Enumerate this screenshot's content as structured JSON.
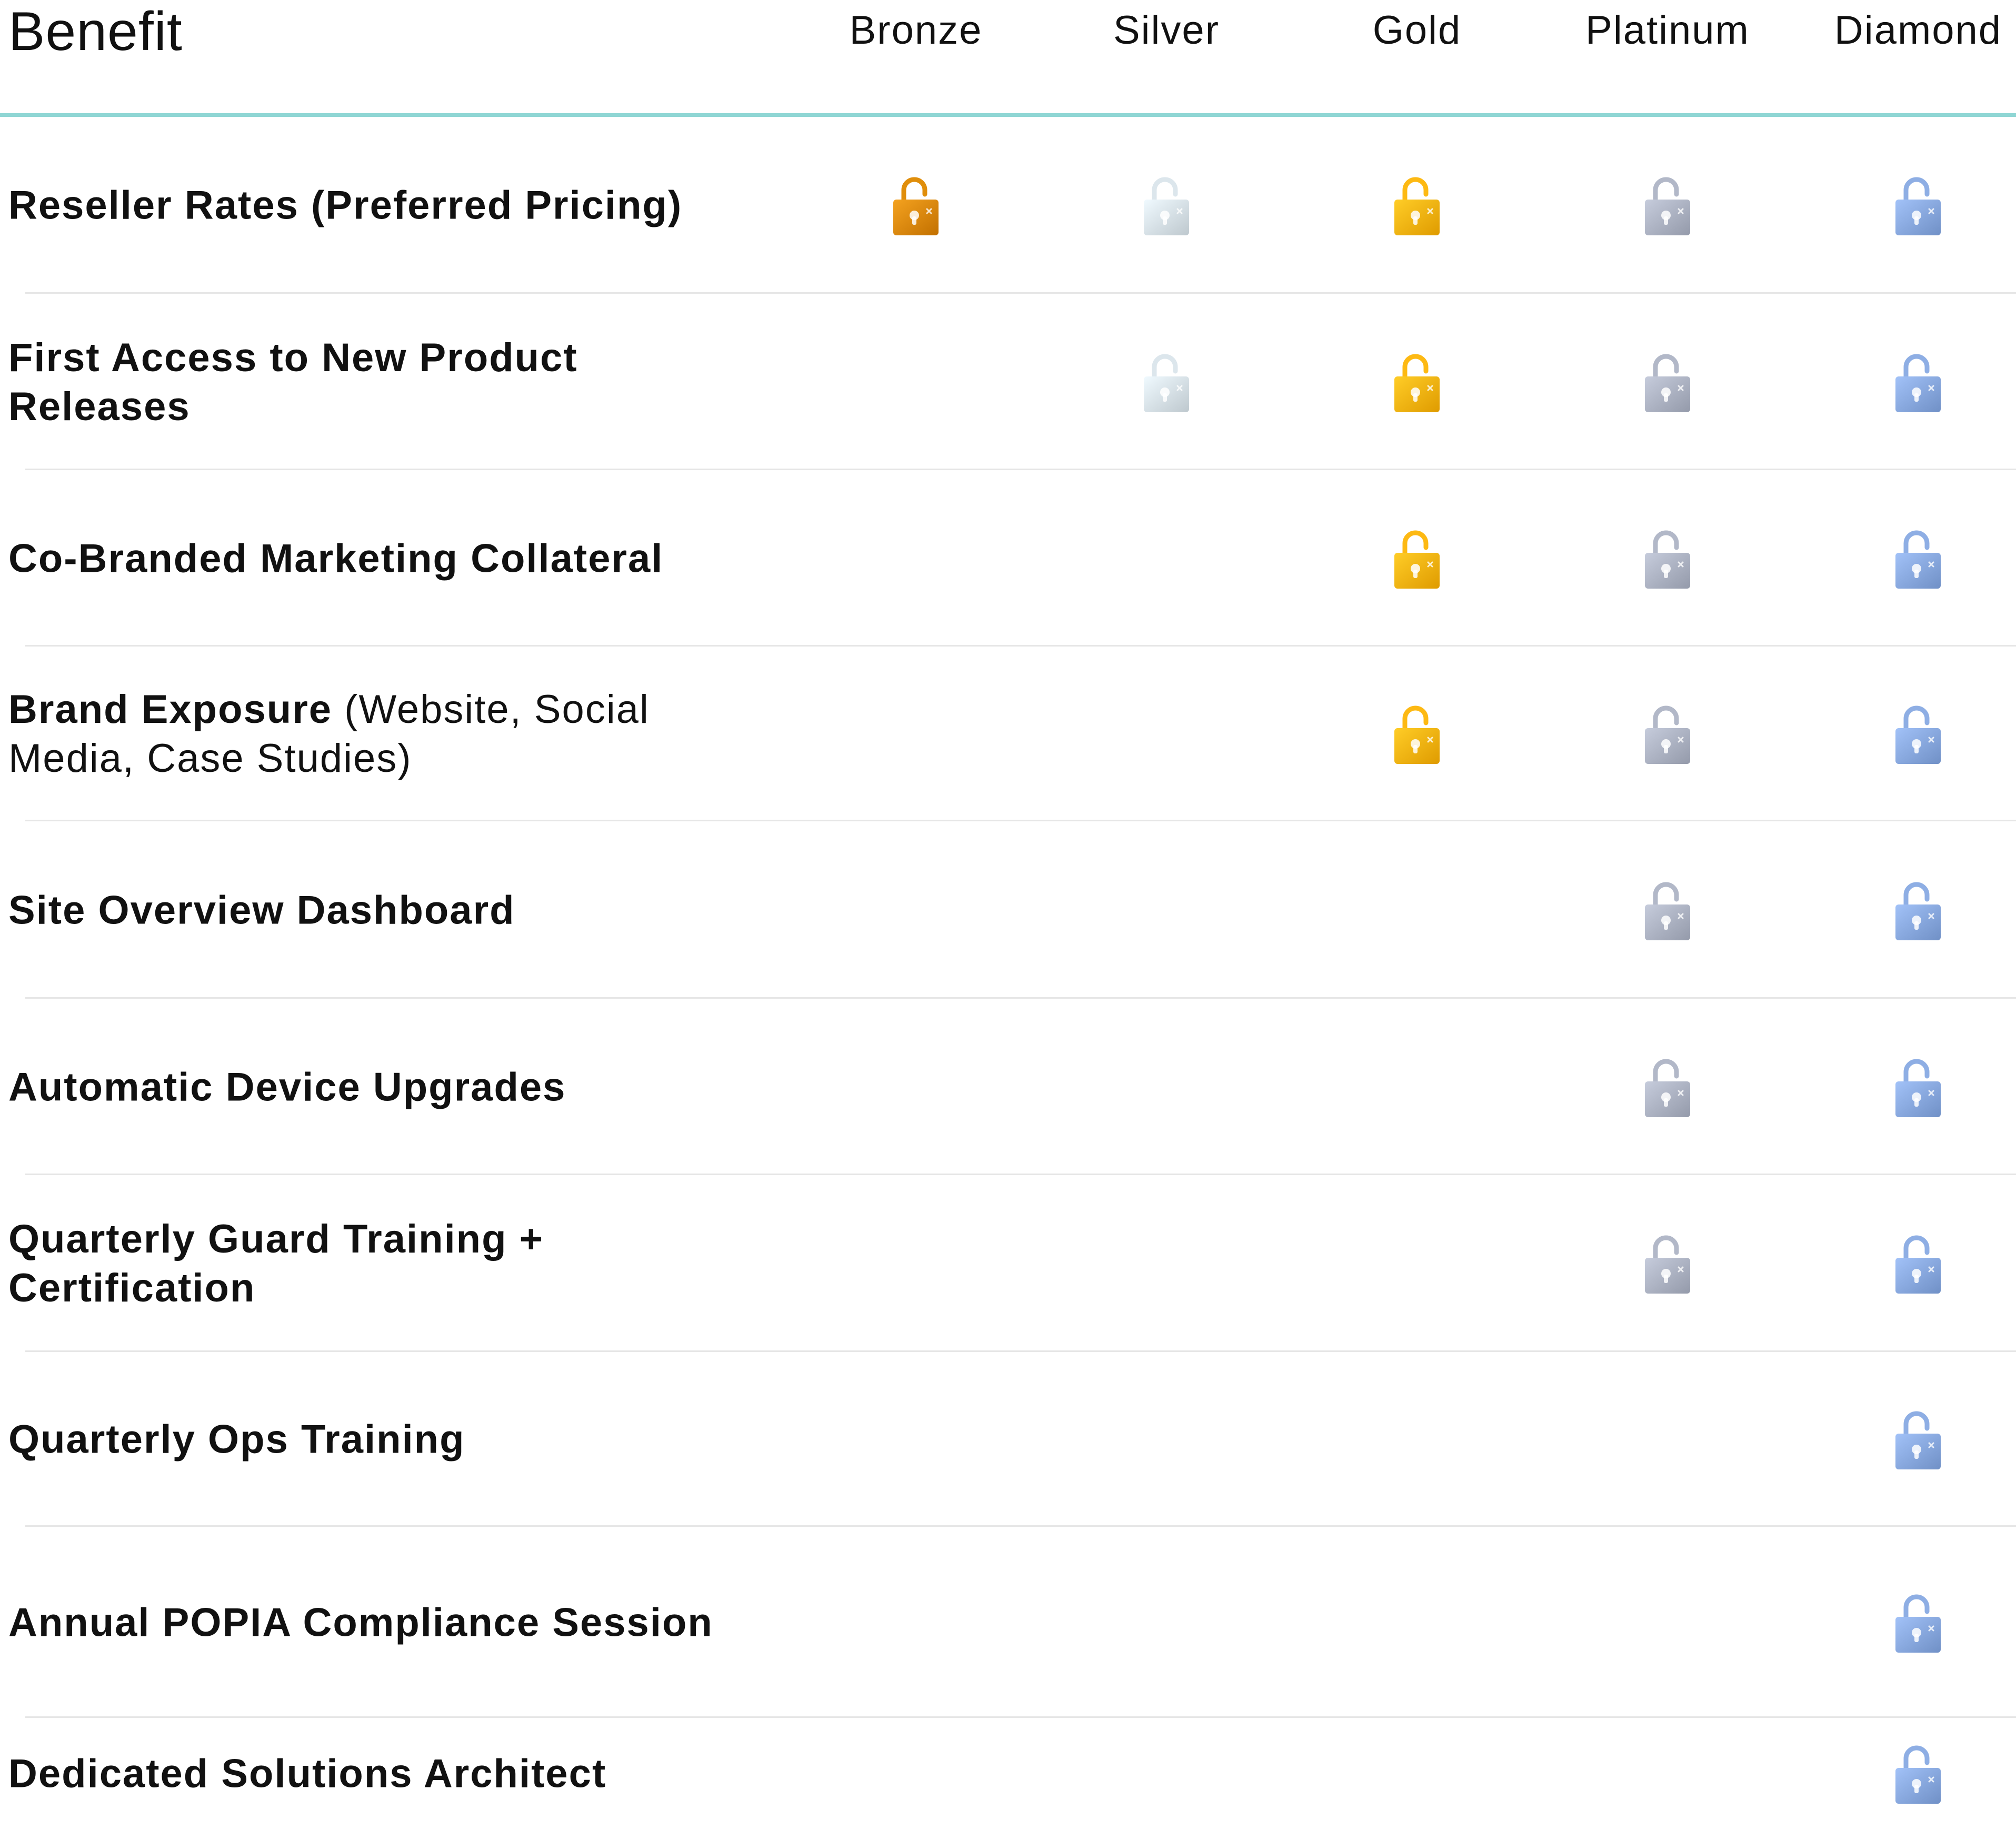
{
  "header": {
    "benefit_label": "Benefit",
    "tiers": [
      {
        "key": "bronze",
        "label": "Bronze",
        "color": "#e08e0b"
      },
      {
        "key": "silver",
        "label": "Silver",
        "color": "#dce6ec"
      },
      {
        "key": "gold",
        "label": "Gold",
        "color": "#fdb913"
      },
      {
        "key": "platinum",
        "label": "Platinum",
        "color": "#b2b8c8"
      },
      {
        "key": "diamond",
        "label": "Diamond",
        "color": "#8eaee4"
      }
    ]
  },
  "colors": {
    "header_rule": "#8fd6d4",
    "row_divider": "#e6e6e6"
  },
  "rows": [
    {
      "label_bold": "Reseller Rates (Preferred Pricing)",
      "label_light": "",
      "included": {
        "bronze": true,
        "silver": true,
        "gold": true,
        "platinum": true,
        "diamond": true
      }
    },
    {
      "label_bold": "First Access to New Product Releases",
      "label_light": "",
      "included": {
        "bronze": false,
        "silver": true,
        "gold": true,
        "platinum": true,
        "diamond": true
      }
    },
    {
      "label_bold": "Co-Branded Marketing Collateral",
      "label_light": "",
      "included": {
        "bronze": false,
        "silver": false,
        "gold": true,
        "platinum": true,
        "diamond": true
      }
    },
    {
      "label_bold": "Brand Exposure",
      "label_light": " (Website, Social Media, Case Studies)",
      "included": {
        "bronze": false,
        "silver": false,
        "gold": true,
        "platinum": true,
        "diamond": true
      }
    },
    {
      "label_bold": "Site Overview Dashboard",
      "label_light": "",
      "included": {
        "bronze": false,
        "silver": false,
        "gold": false,
        "platinum": true,
        "diamond": true
      }
    },
    {
      "label_bold": "Automatic Device Upgrades",
      "label_light": "",
      "included": {
        "bronze": false,
        "silver": false,
        "gold": false,
        "platinum": true,
        "diamond": true
      }
    },
    {
      "label_bold": "Quarterly Guard Training + Certification",
      "label_light": "",
      "included": {
        "bronze": false,
        "silver": false,
        "gold": false,
        "platinum": true,
        "diamond": true
      }
    },
    {
      "label_bold": "Quarterly Ops Training",
      "label_light": "",
      "included": {
        "bronze": false,
        "silver": false,
        "gold": false,
        "platinum": false,
        "diamond": true
      }
    },
    {
      "label_bold": "Annual POPIA Compliance Session",
      "label_light": "",
      "included": {
        "bronze": false,
        "silver": false,
        "gold": false,
        "platinum": false,
        "diamond": true
      }
    },
    {
      "label_bold": "Dedicated Solutions Architect",
      "label_light": "",
      "included": {
        "bronze": false,
        "silver": false,
        "gold": false,
        "platinum": false,
        "diamond": true
      }
    }
  ],
  "icon": "unlocked-padlock-icon"
}
